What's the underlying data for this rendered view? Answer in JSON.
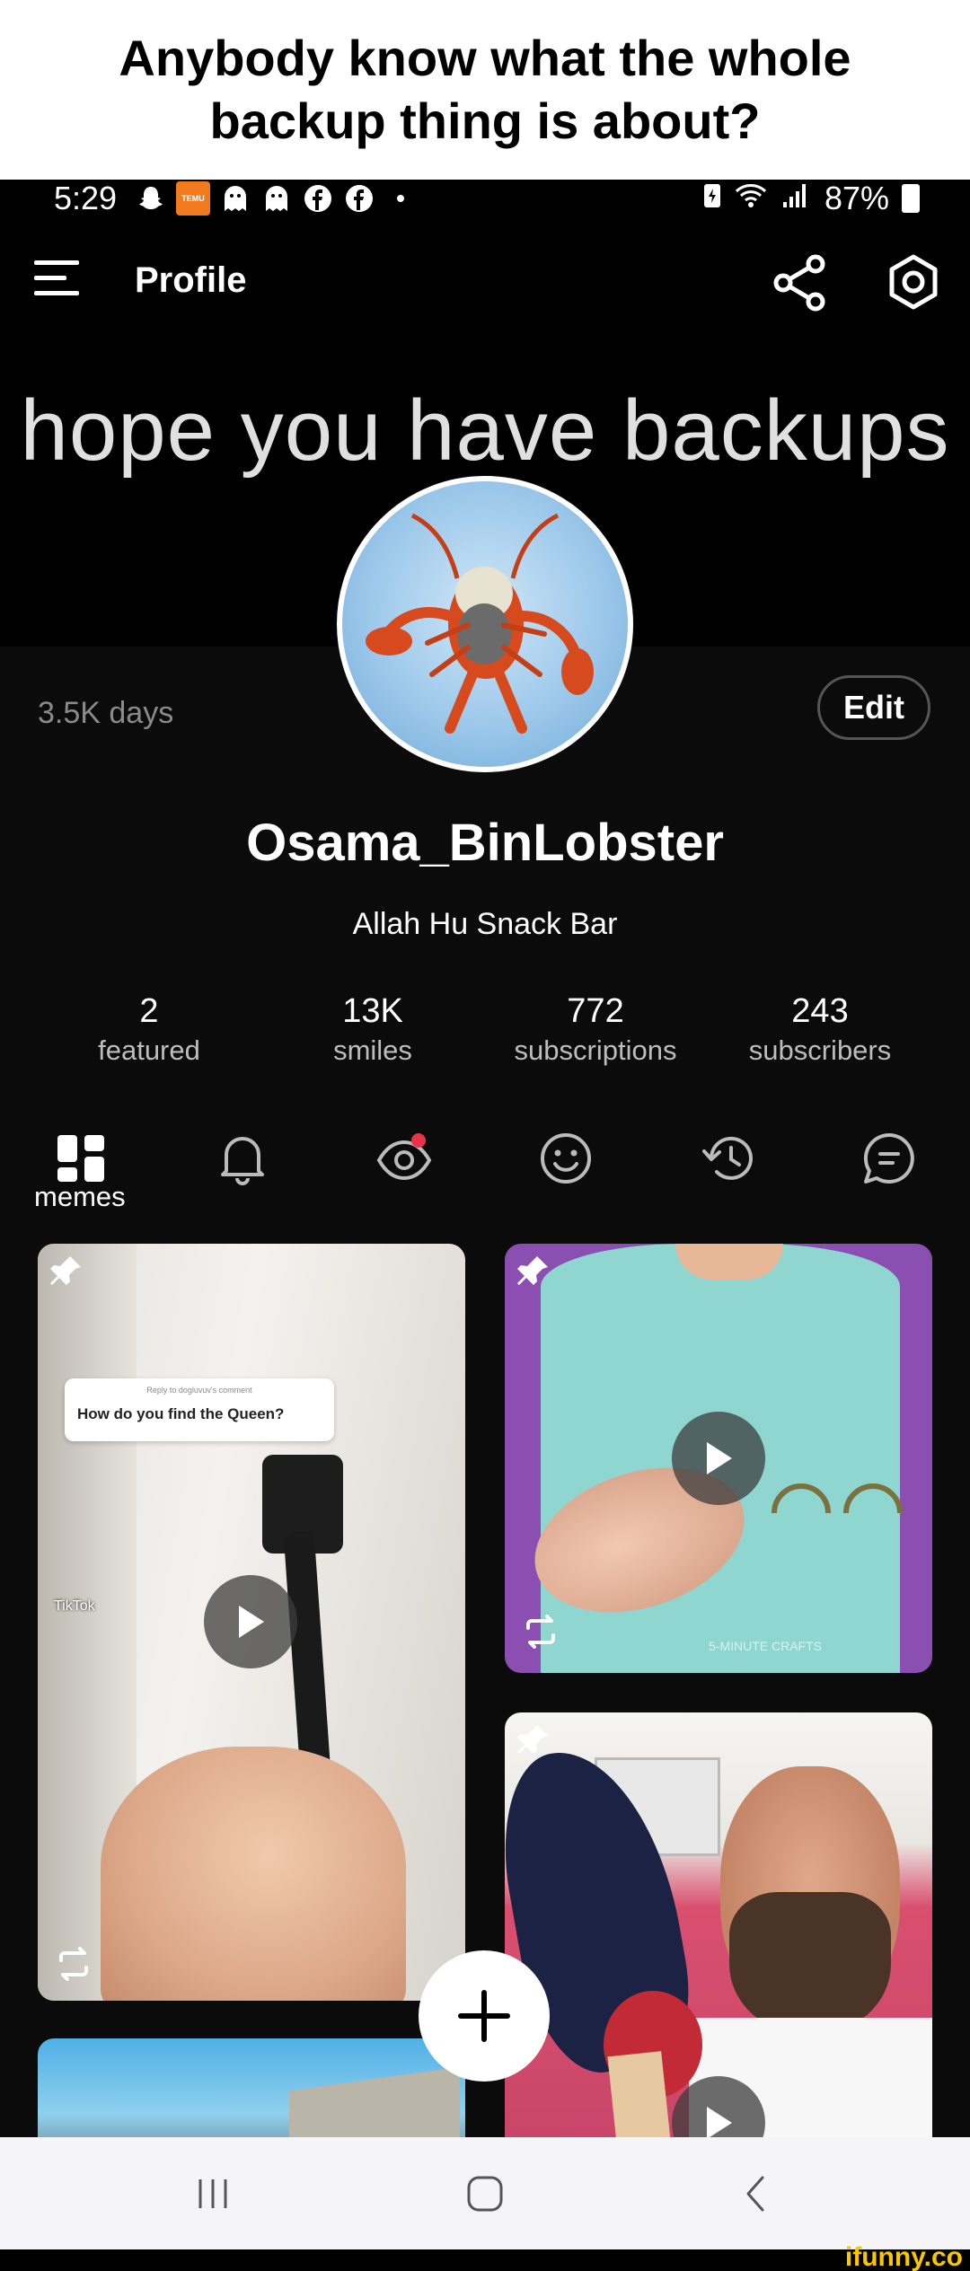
{
  "caption": {
    "text": "Anybody know what the whole backup thing is about?"
  },
  "status_bar": {
    "time": "5:29",
    "battery": "87%",
    "left_icons": [
      "snapchat-icon",
      "temu-icon",
      "ghost-icon",
      "ghost-icon",
      "facebook-icon",
      "facebook-icon",
      "dot-icon"
    ],
    "temu_label": "TEMU",
    "right_icons": [
      "battery-saver-icon",
      "wifi-icon",
      "signal-icon",
      "battery-icon"
    ]
  },
  "topbar": {
    "title": "Profile",
    "icons": [
      "menu-icon",
      "share-icon",
      "settings-icon"
    ]
  },
  "banner": {
    "text": "hope you have backups"
  },
  "profile": {
    "days": "3.5K days",
    "edit_label": "Edit",
    "username": "Osama_BinLobster",
    "bio": "Allah Hu Snack Bar"
  },
  "stats": [
    {
      "value": "2",
      "label": "featured"
    },
    {
      "value": "13K",
      "label": "smiles"
    },
    {
      "value": "772",
      "label": "subscriptions"
    },
    {
      "value": "243",
      "label": "subscribers"
    }
  ],
  "tabs": {
    "active_label": "memes",
    "icons": [
      "memes-grid-icon",
      "bell-icon",
      "eye-icon",
      "smile-icon",
      "history-icon",
      "comment-icon"
    ]
  },
  "cards": [
    {
      "caption_small": "Reply to dogluvuv's comment",
      "caption": "How do you find the Queen?",
      "tiktok": "TikTok"
    },
    {
      "watermark": "5-MINUTE CRAFTS"
    },
    {},
    {}
  ],
  "colors": {
    "screen_bg": "#000000",
    "body_bg": "#0b0b0b",
    "notification_dot": "#e8344a",
    "watermark": "#f7c800"
  },
  "watermark": "ifunny.co"
}
